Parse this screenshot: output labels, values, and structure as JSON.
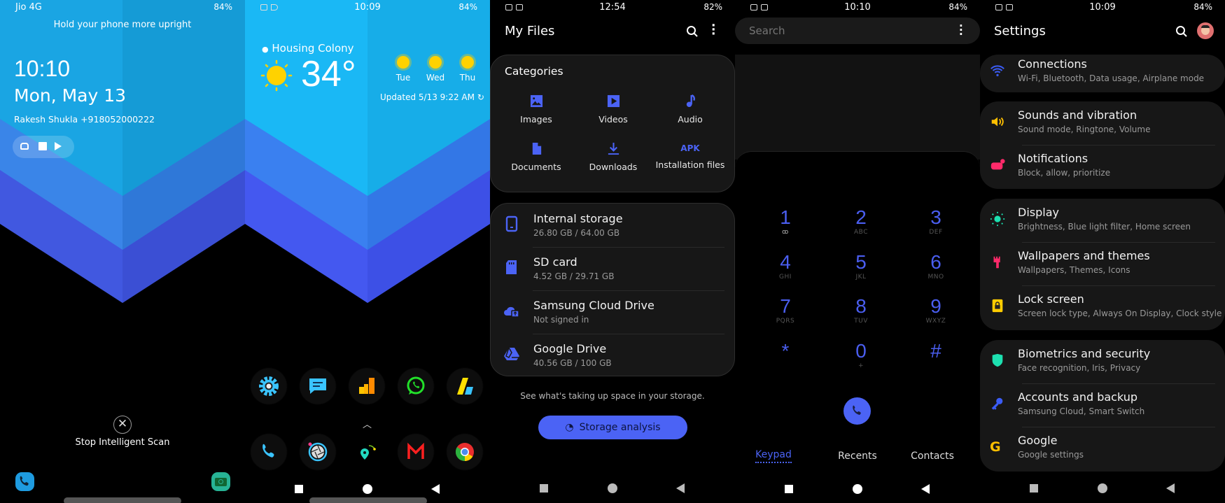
{
  "lockscreen": {
    "status": {
      "carrier": "Jio 4G",
      "battery": "84%"
    },
    "hint": "Hold your phone more upright",
    "time": "10:10",
    "date": "Mon, May 13",
    "owner_info": "Rakesh Shukla +918052000222",
    "notification_icons": [
      "gamepad-icon",
      "image-icon",
      "play-store-icon"
    ],
    "stop_scan_label": "Stop Intelligent Scan",
    "shortcuts": [
      "phone-icon",
      "camera-icon"
    ],
    "colors": {
      "top": "#1aa5e3",
      "band1": "#3a85e8",
      "band2": "#4158e0"
    }
  },
  "homescreen": {
    "status": {
      "time": "10:09",
      "battery": "84%"
    },
    "weather": {
      "location": "Housing Colony",
      "temperature": "34°",
      "forecast": [
        {
          "day": "Tue"
        },
        {
          "day": "Wed"
        },
        {
          "day": "Thu"
        }
      ],
      "updated": "Updated 5/13 9:22 AM"
    },
    "apps_row1": [
      "Settings",
      "Messages",
      "Analytics",
      "WhatsApp",
      "AdSense"
    ],
    "apps_row2": [
      "Phone",
      "Camera",
      "Maps",
      "Gmail",
      "Chrome"
    ]
  },
  "myfiles": {
    "status": {
      "time": "12:54",
      "battery": "82%"
    },
    "title": "My Files",
    "categories_title": "Categories",
    "categories": [
      {
        "label": "Images",
        "icon": "image-icon"
      },
      {
        "label": "Videos",
        "icon": "video-icon"
      },
      {
        "label": "Audio",
        "icon": "music-note-icon"
      },
      {
        "label": "Documents",
        "icon": "document-icon"
      },
      {
        "label": "Downloads",
        "icon": "download-icon"
      },
      {
        "label": "Installation files",
        "icon": "apk-icon",
        "glyph": "APK"
      }
    ],
    "storage": [
      {
        "name": "Internal storage",
        "detail": "26.80 GB / 64.00 GB"
      },
      {
        "name": "SD card",
        "detail": "4.52 GB / 29.71 GB"
      },
      {
        "name": "Samsung Cloud Drive",
        "detail": "Not signed in"
      },
      {
        "name": "Google Drive",
        "detail": "40.56 GB / 100 GB"
      }
    ],
    "hint": "See what's taking up space in your storage.",
    "analysis_button": "Storage analysis",
    "accent": "#4b63f5"
  },
  "dialer": {
    "status": {
      "time": "10:10",
      "battery": "84%"
    },
    "search_placeholder": "Search",
    "keys": [
      {
        "digit": "1",
        "sub": "ꝏ"
      },
      {
        "digit": "2",
        "sub": "ABC"
      },
      {
        "digit": "3",
        "sub": "DEF"
      },
      {
        "digit": "4",
        "sub": "GHI"
      },
      {
        "digit": "5",
        "sub": "JKL"
      },
      {
        "digit": "6",
        "sub": "MNO"
      },
      {
        "digit": "7",
        "sub": "PQRS"
      },
      {
        "digit": "8",
        "sub": "TUV"
      },
      {
        "digit": "9",
        "sub": "WXYZ"
      },
      {
        "digit": "*",
        "sub": ""
      },
      {
        "digit": "0",
        "sub": "+"
      },
      {
        "digit": "#",
        "sub": ""
      }
    ],
    "tabs": [
      {
        "label": "Keypad",
        "active": true
      },
      {
        "label": "Recents",
        "active": false
      },
      {
        "label": "Contacts",
        "active": false
      }
    ]
  },
  "settings": {
    "status": {
      "time": "10:09",
      "battery": "84%"
    },
    "title": "Settings",
    "items": [
      {
        "title": "Connections",
        "subtitle": "Wi-Fi, Bluetooth, Data usage, Airplane mode"
      },
      {
        "title": "Sounds and vibration",
        "subtitle": "Sound mode, Ringtone, Volume"
      },
      {
        "title": "Notifications",
        "subtitle": "Block, allow, prioritize"
      },
      {
        "title": "Display",
        "subtitle": "Brightness, Blue light filter, Home screen"
      },
      {
        "title": "Wallpapers and themes",
        "subtitle": "Wallpapers, Themes, Icons"
      },
      {
        "title": "Lock screen",
        "subtitle": "Screen lock type, Always On Display, Clock style"
      },
      {
        "title": "Biometrics and security",
        "subtitle": "Face recognition, Iris, Privacy"
      },
      {
        "title": "Accounts and backup",
        "subtitle": "Samsung Cloud, Smart Switch"
      },
      {
        "title": "Google",
        "subtitle": "Google settings"
      }
    ]
  }
}
